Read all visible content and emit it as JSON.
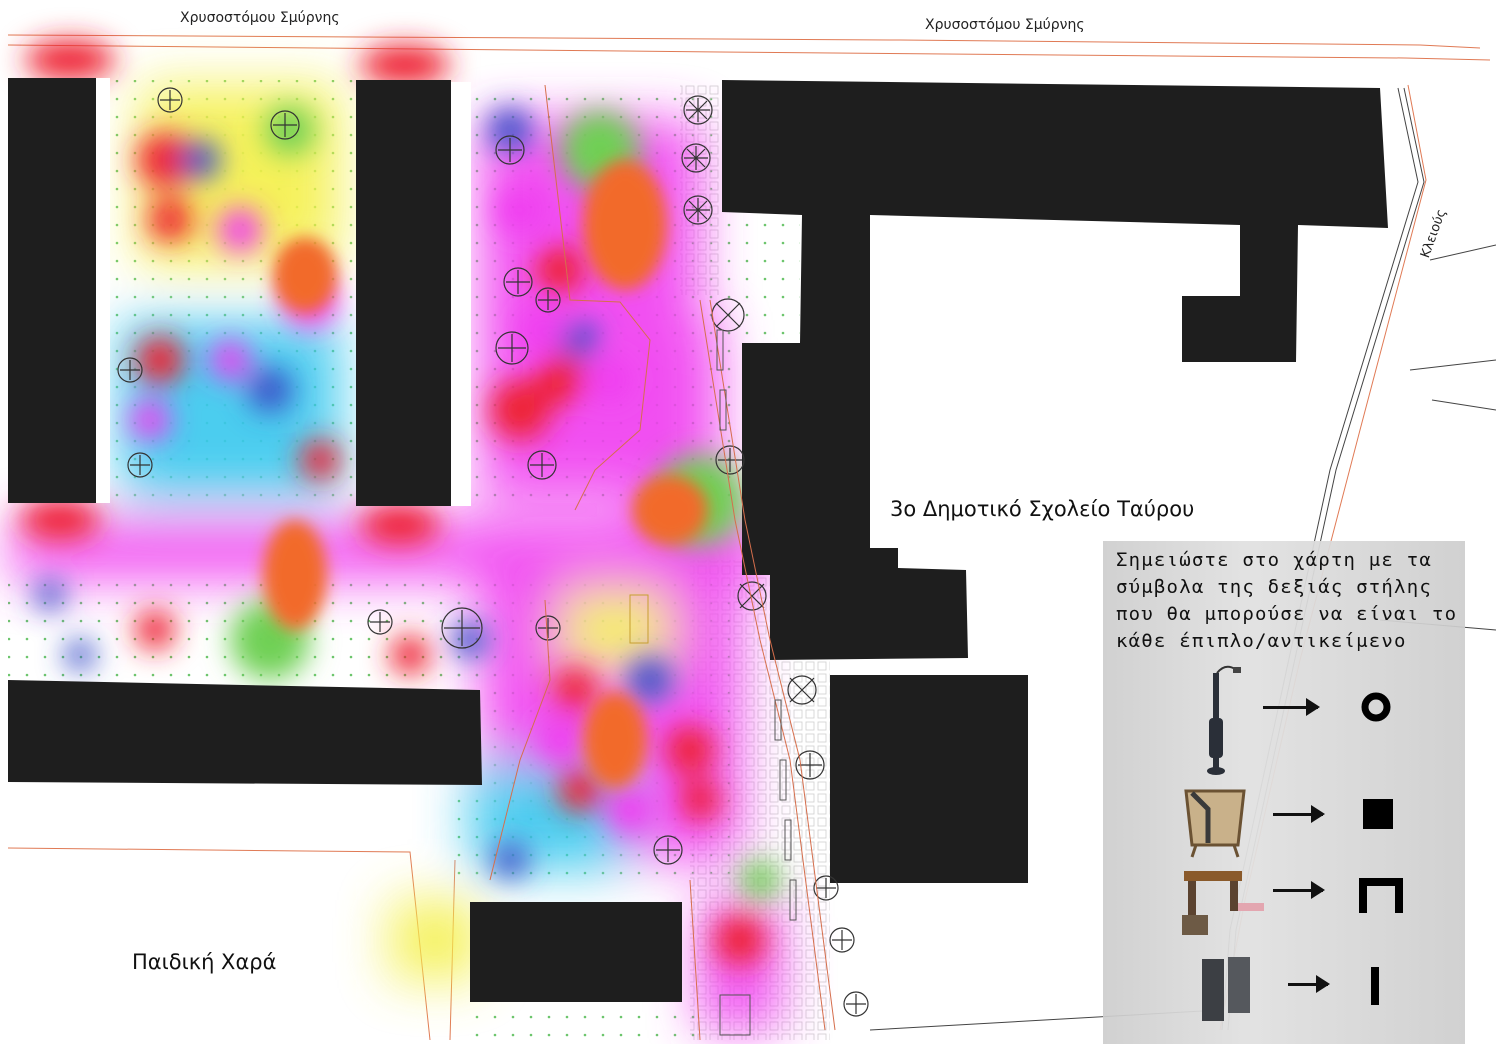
{
  "labels": {
    "street_top_left": "Χρυσοστόμου Σμύρνης",
    "street_top_right": "Χρυσοστόμου Σμύρνης",
    "street_side": "Κλειούς",
    "school": "3ο Δημοτικό Σχολείο Ταύρου",
    "playground": "Παιδική Χαρά"
  },
  "legend": {
    "instruction": "Σημειώστε στο χάρτη με τα σύμβολα της δεξιάς στήλης που θα μπορούσε να είναι το κάθε έπιπλο/αντικείμενο",
    "items": [
      {
        "object": "street-lamp",
        "symbol": "ring"
      },
      {
        "object": "waste-bin",
        "symbol": "filled-square"
      },
      {
        "object": "bench",
        "symbol": "bench-shape"
      },
      {
        "object": "bollards",
        "symbol": "vertical-bar"
      }
    ]
  },
  "colors": {
    "building": "#1e1e1e",
    "heat_red": "#ee2233",
    "heat_orange": "#f26a2a",
    "heat_magenta": "#f03cf0",
    "heat_blue": "#3a4fc8",
    "heat_green": "#6fd055",
    "heat_yellow": "#f4f04a",
    "heat_cyan": "#38c8ee",
    "boundary_line": "#e07a55"
  }
}
